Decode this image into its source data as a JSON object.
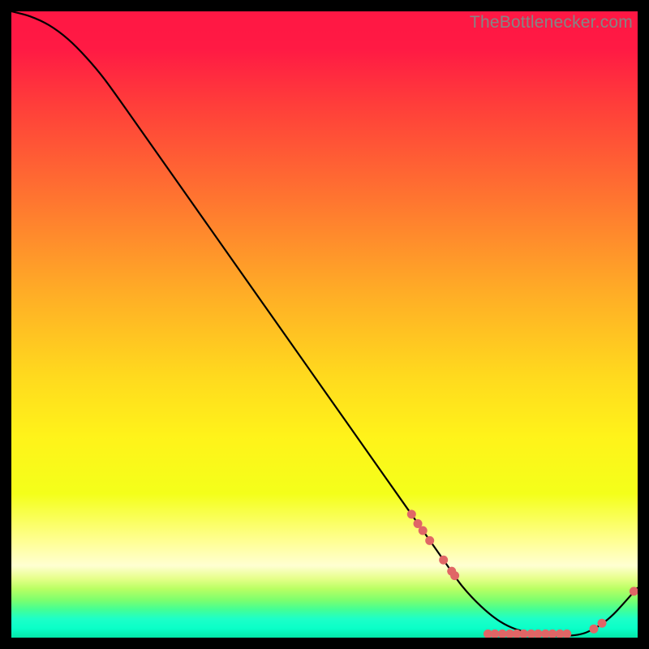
{
  "watermark": "TheBottlenecker.com",
  "chart_data": {
    "type": "line",
    "title": "",
    "xlabel": "",
    "ylabel": "",
    "xlim": [
      0,
      100
    ],
    "ylim": [
      0,
      100
    ],
    "grid": false,
    "gradient_stops": [
      {
        "offset": 0.0,
        "color": "#ff1744"
      },
      {
        "offset": 0.06,
        "color": "#ff1a44"
      },
      {
        "offset": 0.15,
        "color": "#ff3e3a"
      },
      {
        "offset": 0.3,
        "color": "#ff7530"
      },
      {
        "offset": 0.45,
        "color": "#ffad26"
      },
      {
        "offset": 0.58,
        "color": "#ffd91e"
      },
      {
        "offset": 0.68,
        "color": "#fff31a"
      },
      {
        "offset": 0.77,
        "color": "#f4ff1a"
      },
      {
        "offset": 0.845,
        "color": "#ffff92"
      },
      {
        "offset": 0.885,
        "color": "#ffffd2"
      },
      {
        "offset": 0.905,
        "color": "#e7ff8c"
      },
      {
        "offset": 0.922,
        "color": "#b9ff63"
      },
      {
        "offset": 0.94,
        "color": "#7dff6e"
      },
      {
        "offset": 0.955,
        "color": "#44ff95"
      },
      {
        "offset": 0.97,
        "color": "#1dffc8"
      },
      {
        "offset": 0.985,
        "color": "#0affc8"
      },
      {
        "offset": 1.0,
        "color": "#04e6a8"
      }
    ],
    "series": [
      {
        "name": "bottleneck-curve",
        "color": "#000000",
        "x": [
          0,
          3,
          6,
          9,
          12,
          15,
          20,
          30,
          40,
          50,
          60,
          65,
          69,
          72,
          75,
          78,
          81,
          85,
          90,
          93,
          96,
          100
        ],
        "y": [
          100.0,
          99.2,
          97.8,
          95.6,
          92.6,
          89.0,
          82.0,
          67.8,
          53.6,
          39.4,
          25.2,
          18.1,
          12.4,
          8.2,
          5.0,
          2.6,
          1.2,
          0.4,
          0.4,
          1.4,
          3.6,
          8.0
        ]
      }
    ],
    "markers": {
      "name": "sample-points",
      "color": "#e06666",
      "radius": 5.5,
      "points": [
        {
          "x": 63.9,
          "y": 19.7
        },
        {
          "x": 64.9,
          "y": 18.2
        },
        {
          "x": 65.7,
          "y": 17.1
        },
        {
          "x": 66.8,
          "y": 15.5
        },
        {
          "x": 69.0,
          "y": 12.4
        },
        {
          "x": 70.3,
          "y": 10.6
        },
        {
          "x": 70.8,
          "y": 9.9
        },
        {
          "x": 76.1,
          "y": 0.6
        },
        {
          "x": 77.2,
          "y": 0.6
        },
        {
          "x": 78.4,
          "y": 0.6
        },
        {
          "x": 79.6,
          "y": 0.6
        },
        {
          "x": 80.7,
          "y": 0.6
        },
        {
          "x": 81.8,
          "y": 0.6
        },
        {
          "x": 83.0,
          "y": 0.6
        },
        {
          "x": 84.1,
          "y": 0.6
        },
        {
          "x": 85.3,
          "y": 0.6
        },
        {
          "x": 86.4,
          "y": 0.6
        },
        {
          "x": 87.6,
          "y": 0.6
        },
        {
          "x": 88.7,
          "y": 0.6
        },
        {
          "x": 93.0,
          "y": 1.4
        },
        {
          "x": 94.3,
          "y": 2.3
        },
        {
          "x": 99.4,
          "y": 7.4
        }
      ]
    }
  }
}
